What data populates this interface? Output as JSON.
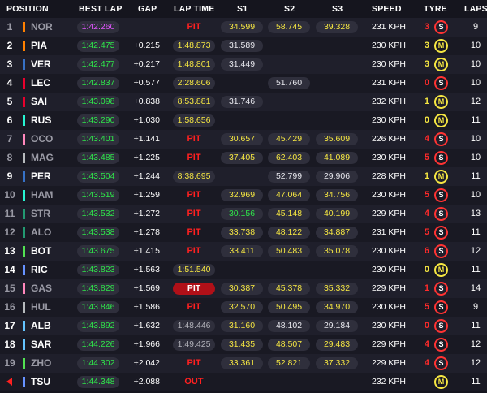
{
  "header": {
    "position": "POSITION",
    "best_lap": "BEST LAP",
    "gap": "GAP",
    "lap_time": "LAP TIME",
    "s1": "S1",
    "s2": "S2",
    "s3": "S3",
    "speed": "SPEED",
    "tyre": "TYRE",
    "laps": "LAPS"
  },
  "colors": {
    "sector_yellow": "#f5e642",
    "sector_green": "#2ee64a",
    "fastest_purple": "#e056fd",
    "pit_red": "#ff2020",
    "soft_red": "#ff3333",
    "medium_yellow": "#f5e642"
  },
  "rows": [
    {
      "pos": "1",
      "code": "NOR",
      "team_color": "#ff8000",
      "best": "1:42.260",
      "best_color": "purple",
      "gap": "",
      "lap_time": "PIT",
      "lt_style": "pit",
      "s1": "34.599",
      "s1c": "y",
      "s2": "58.745",
      "s2c": "y",
      "s3": "39.328",
      "s3c": "y",
      "speed": "231 KPH",
      "stint": "3",
      "stint_color": "red",
      "tyre": "S",
      "tyre_type": "soft",
      "laps": "9",
      "retired": true
    },
    {
      "pos": "2",
      "code": "PIA",
      "team_color": "#ff8000",
      "best": "1:42.475",
      "best_color": "green",
      "gap": "+0.215",
      "lap_time": "1:48.873",
      "lt_style": "yellow",
      "s1": "31.589",
      "s1c": "w",
      "s2": "",
      "s2c": "",
      "s3": "",
      "s3c": "",
      "speed": "230 KPH",
      "stint": "3",
      "stint_color": "yellow",
      "tyre": "M",
      "tyre_type": "medium",
      "laps": "10"
    },
    {
      "pos": "3",
      "code": "VER",
      "team_color": "#3671c6",
      "best": "1:42.477",
      "best_color": "green",
      "gap": "+0.217",
      "lap_time": "1:48.801",
      "lt_style": "yellow",
      "s1": "31.449",
      "s1c": "w",
      "s2": "",
      "s2c": "",
      "s3": "",
      "s3c": "",
      "speed": "230 KPH",
      "stint": "3",
      "stint_color": "yellow",
      "tyre": "M",
      "tyre_type": "medium",
      "laps": "10"
    },
    {
      "pos": "4",
      "code": "LEC",
      "team_color": "#e8002d",
      "best": "1:42.837",
      "best_color": "green",
      "gap": "+0.577",
      "lap_time": "2:28.606",
      "lt_style": "yellow",
      "s1": "",
      "s1c": "",
      "s2": "51.760",
      "s2c": "w",
      "s3": "",
      "s3c": "",
      "speed": "231 KPH",
      "stint": "0",
      "stint_color": "red",
      "tyre": "S",
      "tyre_type": "soft",
      "laps": "10"
    },
    {
      "pos": "5",
      "code": "SAI",
      "team_color": "#e8002d",
      "best": "1:43.098",
      "best_color": "green",
      "gap": "+0.838",
      "lap_time": "8:53.881",
      "lt_style": "yellow",
      "s1": "31.746",
      "s1c": "w",
      "s2": "",
      "s2c": "",
      "s3": "",
      "s3c": "",
      "speed": "232 KPH",
      "stint": "1",
      "stint_color": "yellow",
      "tyre": "M",
      "tyre_type": "medium",
      "laps": "12"
    },
    {
      "pos": "6",
      "code": "RUS",
      "team_color": "#27f4d2",
      "best": "1:43.290",
      "best_color": "green",
      "gap": "+1.030",
      "lap_time": "1:58.656",
      "lt_style": "yellow",
      "s1": "",
      "s1c": "",
      "s2": "",
      "s2c": "",
      "s3": "",
      "s3c": "",
      "speed": "230 KPH",
      "stint": "0",
      "stint_color": "yellow",
      "tyre": "M",
      "tyre_type": "medium",
      "laps": "11"
    },
    {
      "pos": "7",
      "code": "OCO",
      "team_color": "#ff87bc",
      "best": "1:43.401",
      "best_color": "green",
      "gap": "+1.141",
      "lap_time": "PIT",
      "lt_style": "pit",
      "s1": "30.657",
      "s1c": "y",
      "s2": "45.429",
      "s2c": "y",
      "s3": "35.609",
      "s3c": "y",
      "speed": "226 KPH",
      "stint": "4",
      "stint_color": "red",
      "tyre": "S",
      "tyre_type": "soft",
      "laps": "10",
      "retired": true
    },
    {
      "pos": "8",
      "code": "MAG",
      "team_color": "#b6babd",
      "best": "1:43.485",
      "best_color": "green",
      "gap": "+1.225",
      "lap_time": "PIT",
      "lt_style": "pit",
      "s1": "37.405",
      "s1c": "y",
      "s2": "62.403",
      "s2c": "y",
      "s3": "41.089",
      "s3c": "y",
      "speed": "230 KPH",
      "stint": "5",
      "stint_color": "red",
      "tyre": "S",
      "tyre_type": "soft",
      "laps": "10",
      "retired": true
    },
    {
      "pos": "9",
      "code": "PER",
      "team_color": "#3671c6",
      "best": "1:43.504",
      "best_color": "green",
      "gap": "+1.244",
      "lap_time": "8:38.695",
      "lt_style": "yellow",
      "s1": "",
      "s1c": "",
      "s2": "52.799",
      "s2c": "w",
      "s3": "29.906",
      "s3c": "w",
      "speed": "228 KPH",
      "stint": "1",
      "stint_color": "yellow",
      "tyre": "M",
      "tyre_type": "medium",
      "laps": "11"
    },
    {
      "pos": "10",
      "code": "HAM",
      "team_color": "#27f4d2",
      "best": "1:43.519",
      "best_color": "green",
      "gap": "+1.259",
      "lap_time": "PIT",
      "lt_style": "pit",
      "s1": "32.969",
      "s1c": "y",
      "s2": "47.064",
      "s2c": "y",
      "s3": "34.756",
      "s3c": "y",
      "speed": "230 KPH",
      "stint": "5",
      "stint_color": "red",
      "tyre": "S",
      "tyre_type": "soft",
      "laps": "10",
      "retired": true
    },
    {
      "pos": "11",
      "code": "STR",
      "team_color": "#229971",
      "best": "1:43.532",
      "best_color": "green",
      "gap": "+1.272",
      "lap_time": "PIT",
      "lt_style": "pit",
      "s1": "30.156",
      "s1c": "g",
      "s2": "45.148",
      "s2c": "y",
      "s3": "40.199",
      "s3c": "y",
      "speed": "229 KPH",
      "stint": "4",
      "stint_color": "red",
      "tyre": "S",
      "tyre_type": "soft",
      "laps": "13",
      "retired": true
    },
    {
      "pos": "12",
      "code": "ALO",
      "team_color": "#229971",
      "best": "1:43.538",
      "best_color": "green",
      "gap": "+1.278",
      "lap_time": "PIT",
      "lt_style": "pit",
      "s1": "33.738",
      "s1c": "y",
      "s2": "48.122",
      "s2c": "y",
      "s3": "34.887",
      "s3c": "y",
      "speed": "231 KPH",
      "stint": "5",
      "stint_color": "red",
      "tyre": "S",
      "tyre_type": "soft",
      "laps": "11",
      "retired": true
    },
    {
      "pos": "13",
      "code": "BOT",
      "team_color": "#52e252",
      "best": "1:43.675",
      "best_color": "green",
      "gap": "+1.415",
      "lap_time": "PIT",
      "lt_style": "pit",
      "s1": "33.411",
      "s1c": "y",
      "s2": "50.483",
      "s2c": "y",
      "s3": "35.078",
      "s3c": "y",
      "speed": "230 KPH",
      "stint": "6",
      "stint_color": "red",
      "tyre": "S",
      "tyre_type": "soft",
      "laps": "12"
    },
    {
      "pos": "14",
      "code": "RIC",
      "team_color": "#6692ff",
      "best": "1:43.823",
      "best_color": "green",
      "gap": "+1.563",
      "lap_time": "1:51.540",
      "lt_style": "yellow",
      "s1": "",
      "s1c": "",
      "s2": "",
      "s2c": "",
      "s3": "",
      "s3c": "",
      "speed": "230 KPH",
      "stint": "0",
      "stint_color": "yellow",
      "tyre": "M",
      "tyre_type": "medium",
      "laps": "11"
    },
    {
      "pos": "15",
      "code": "GAS",
      "team_color": "#ff87bc",
      "best": "1:43.829",
      "best_color": "green",
      "gap": "+1.569",
      "lap_time": "PIT",
      "lt_style": "pitred",
      "s1": "30.387",
      "s1c": "y",
      "s2": "45.378",
      "s2c": "y",
      "s3": "35.332",
      "s3c": "y",
      "speed": "229 KPH",
      "stint": "1",
      "stint_color": "red",
      "tyre": "S",
      "tyre_type": "soft",
      "laps": "14",
      "retired": true
    },
    {
      "pos": "16",
      "code": "HUL",
      "team_color": "#b6babd",
      "best": "1:43.846",
      "best_color": "green",
      "gap": "+1.586",
      "lap_time": "PIT",
      "lt_style": "pit",
      "s1": "32.570",
      "s1c": "y",
      "s2": "50.495",
      "s2c": "y",
      "s3": "34.970",
      "s3c": "y",
      "speed": "230 KPH",
      "stint": "5",
      "stint_color": "red",
      "tyre": "S",
      "tyre_type": "soft",
      "laps": "9",
      "retired": true
    },
    {
      "pos": "17",
      "code": "ALB",
      "team_color": "#64c4ff",
      "best": "1:43.892",
      "best_color": "green",
      "gap": "+1.632",
      "lap_time": "1:48.446",
      "lt_style": "grey",
      "s1": "31.160",
      "s1c": "y",
      "s2": "48.102",
      "s2c": "w",
      "s3": "29.184",
      "s3c": "w",
      "speed": "230 KPH",
      "stint": "0",
      "stint_color": "red",
      "tyre": "S",
      "tyre_type": "soft",
      "laps": "11"
    },
    {
      "pos": "18",
      "code": "SAR",
      "team_color": "#64c4ff",
      "best": "1:44.226",
      "best_color": "green",
      "gap": "+1.966",
      "lap_time": "1:49.425",
      "lt_style": "grey",
      "s1": "31.435",
      "s1c": "y",
      "s2": "48.507",
      "s2c": "y",
      "s3": "29.483",
      "s3c": "y",
      "speed": "229 KPH",
      "stint": "4",
      "stint_color": "red",
      "tyre": "S",
      "tyre_type": "soft",
      "laps": "12"
    },
    {
      "pos": "19",
      "code": "ZHO",
      "team_color": "#52e252",
      "best": "1:44.302",
      "best_color": "green",
      "gap": "+2.042",
      "lap_time": "PIT",
      "lt_style": "pit",
      "s1": "33.361",
      "s1c": "y",
      "s2": "52.821",
      "s2c": "y",
      "s3": "37.332",
      "s3c": "y",
      "speed": "229 KPH",
      "stint": "4",
      "stint_color": "red",
      "tyre": "S",
      "tyre_type": "soft",
      "laps": "12",
      "retired": true
    },
    {
      "pos": "",
      "code": "TSU",
      "team_color": "#6692ff",
      "best": "1:44.348",
      "best_color": "green",
      "gap": "+2.088",
      "lap_time": "OUT",
      "lt_style": "out",
      "s1": "",
      "s1c": "",
      "s2": "",
      "s2c": "",
      "s3": "",
      "s3c": "",
      "speed": "232 KPH",
      "stint": "",
      "stint_color": "yellow",
      "tyre": "M",
      "tyre_type": "medium",
      "laps": "11",
      "arrow": true
    }
  ]
}
